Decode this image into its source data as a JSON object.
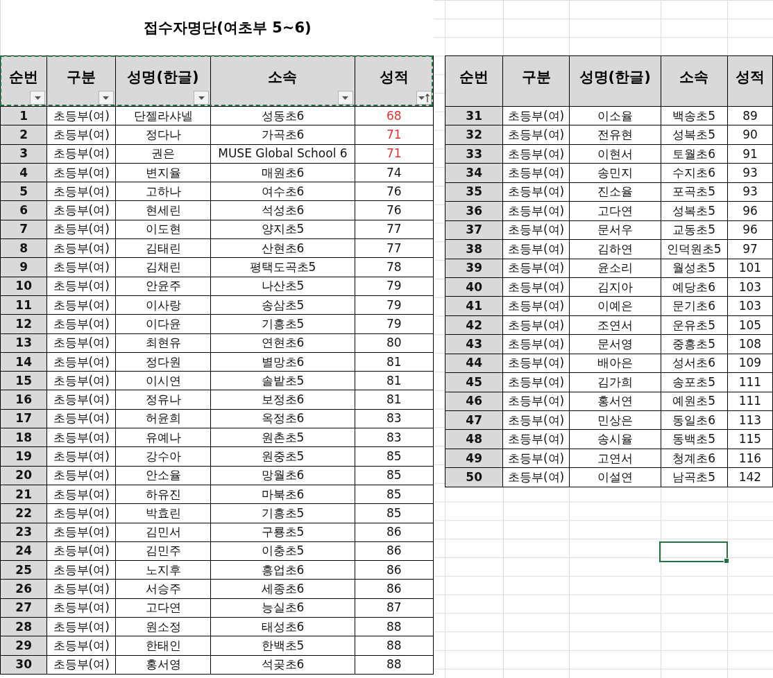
{
  "title": "접수자명단(여초부 5~6)",
  "cell_cursor": true,
  "copy_marquee": true,
  "tables": [
    {
      "columns": [
        {
          "label": "순번",
          "filter_button": true,
          "sorted": false
        },
        {
          "label": "구분",
          "filter_button": true,
          "sorted": false
        },
        {
          "label": "성명(한글)",
          "filter_button": true,
          "sorted": false
        },
        {
          "label": "소속",
          "filter_button": true,
          "sorted": false
        },
        {
          "label": "성적",
          "filter_button": true,
          "sorted": true
        }
      ],
      "rows": [
        {
          "no": "1",
          "category": "초등부(여)",
          "name": "단젤라샤넬",
          "school": "성동초6",
          "score": "68",
          "highlighted": true
        },
        {
          "no": "2",
          "category": "초등부(여)",
          "name": "정다나",
          "school": "가곡초6",
          "score": "71",
          "highlighted": true
        },
        {
          "no": "3",
          "category": "초등부(여)",
          "name": "권은",
          "school": "MUSE Global School 6",
          "score": "71",
          "highlighted": true
        },
        {
          "no": "4",
          "category": "초등부(여)",
          "name": "변지율",
          "school": "매원초6",
          "score": "74",
          "highlighted": false
        },
        {
          "no": "5",
          "category": "초등부(여)",
          "name": "고하나",
          "school": "여수초6",
          "score": "76",
          "highlighted": false
        },
        {
          "no": "6",
          "category": "초등부(여)",
          "name": "현세린",
          "school": "석성초6",
          "score": "76",
          "highlighted": false
        },
        {
          "no": "7",
          "category": "초등부(여)",
          "name": "이도현",
          "school": "양지초5",
          "score": "77",
          "highlighted": false
        },
        {
          "no": "8",
          "category": "초등부(여)",
          "name": "김태린",
          "school": "산현초6",
          "score": "77",
          "highlighted": false
        },
        {
          "no": "9",
          "category": "초등부(여)",
          "name": "김채린",
          "school": "평택도곡초5",
          "score": "78",
          "highlighted": false
        },
        {
          "no": "10",
          "category": "초등부(여)",
          "name": "안윤주",
          "school": "나산초5",
          "score": "79",
          "highlighted": false
        },
        {
          "no": "11",
          "category": "초등부(여)",
          "name": "이사랑",
          "school": "송삼초5",
          "score": "79",
          "highlighted": false
        },
        {
          "no": "12",
          "category": "초등부(여)",
          "name": "이다윤",
          "school": "기흥초5",
          "score": "79",
          "highlighted": false
        },
        {
          "no": "13",
          "category": "초등부(여)",
          "name": "최현유",
          "school": "연현초6",
          "score": "80",
          "highlighted": false
        },
        {
          "no": "14",
          "category": "초등부(여)",
          "name": "정다원",
          "school": "별망초6",
          "score": "81",
          "highlighted": false
        },
        {
          "no": "15",
          "category": "초등부(여)",
          "name": "이시연",
          "school": "솔밭초5",
          "score": "81",
          "highlighted": false
        },
        {
          "no": "16",
          "category": "초등부(여)",
          "name": "정유나",
          "school": "보정초6",
          "score": "81",
          "highlighted": false
        },
        {
          "no": "17",
          "category": "초등부(여)",
          "name": "허윤희",
          "school": "옥정초6",
          "score": "83",
          "highlighted": false
        },
        {
          "no": "18",
          "category": "초등부(여)",
          "name": "유예나",
          "school": "원촌초5",
          "score": "83",
          "highlighted": false
        },
        {
          "no": "19",
          "category": "초등부(여)",
          "name": "강수아",
          "school": "원중초5",
          "score": "85",
          "highlighted": false
        },
        {
          "no": "20",
          "category": "초등부(여)",
          "name": "안소율",
          "school": "망월초6",
          "score": "85",
          "highlighted": false
        },
        {
          "no": "21",
          "category": "초등부(여)",
          "name": "하유진",
          "school": "마북초6",
          "score": "85",
          "highlighted": false
        },
        {
          "no": "22",
          "category": "초등부(여)",
          "name": "박효린",
          "school": "기흥초5",
          "score": "85",
          "highlighted": false
        },
        {
          "no": "23",
          "category": "초등부(여)",
          "name": "김민서",
          "school": "구룡초5",
          "score": "86",
          "highlighted": false
        },
        {
          "no": "24",
          "category": "초등부(여)",
          "name": "김민주",
          "school": "이충초5",
          "score": "86",
          "highlighted": false
        },
        {
          "no": "25",
          "category": "초등부(여)",
          "name": "노지후",
          "school": "흥업초6",
          "score": "86",
          "highlighted": false
        },
        {
          "no": "26",
          "category": "초등부(여)",
          "name": "서승주",
          "school": "세종초6",
          "score": "86",
          "highlighted": false
        },
        {
          "no": "27",
          "category": "초등부(여)",
          "name": "고다연",
          "school": "능실초6",
          "score": "87",
          "highlighted": false
        },
        {
          "no": "28",
          "category": "초등부(여)",
          "name": "원소정",
          "school": "태성초6",
          "score": "88",
          "highlighted": false
        },
        {
          "no": "29",
          "category": "초등부(여)",
          "name": "한태인",
          "school": "한백초5",
          "score": "88",
          "highlighted": false
        },
        {
          "no": "30",
          "category": "초등부(여)",
          "name": "홍서영",
          "school": "석곶초6",
          "score": "88",
          "highlighted": false
        }
      ]
    },
    {
      "columns": [
        {
          "label": "순번"
        },
        {
          "label": "구분"
        },
        {
          "label": "성명(한글)"
        },
        {
          "label": "소속"
        },
        {
          "label": "성적"
        }
      ],
      "rows": [
        {
          "no": "31",
          "category": "초등부(여)",
          "name": "이소율",
          "school": "백송초5",
          "score": "89",
          "highlighted": false
        },
        {
          "no": "32",
          "category": "초등부(여)",
          "name": "전유현",
          "school": "성복초5",
          "score": "90",
          "highlighted": false
        },
        {
          "no": "33",
          "category": "초등부(여)",
          "name": "이현서",
          "school": "토월초6",
          "score": "91",
          "highlighted": false
        },
        {
          "no": "34",
          "category": "초등부(여)",
          "name": "송민지",
          "school": "수지초6",
          "score": "93",
          "highlighted": false
        },
        {
          "no": "35",
          "category": "초등부(여)",
          "name": "진소율",
          "school": "포곡초5",
          "score": "93",
          "highlighted": false
        },
        {
          "no": "36",
          "category": "초등부(여)",
          "name": "고다연",
          "school": "성복초5",
          "score": "96",
          "highlighted": false
        },
        {
          "no": "37",
          "category": "초등부(여)",
          "name": "문서우",
          "school": "교동초5",
          "score": "96",
          "highlighted": false
        },
        {
          "no": "38",
          "category": "초등부(여)",
          "name": "김하연",
          "school": "인덕원초5",
          "score": "97",
          "highlighted": false
        },
        {
          "no": "39",
          "category": "초등부(여)",
          "name": "윤소리",
          "school": "월성초5",
          "score": "101",
          "highlighted": false
        },
        {
          "no": "40",
          "category": "초등부(여)",
          "name": "김지아",
          "school": "예당초6",
          "score": "103",
          "highlighted": false
        },
        {
          "no": "41",
          "category": "초등부(여)",
          "name": "이예은",
          "school": "문기초6",
          "score": "103",
          "highlighted": false
        },
        {
          "no": "42",
          "category": "초등부(여)",
          "name": "조연서",
          "school": "운유초5",
          "score": "105",
          "highlighted": false
        },
        {
          "no": "43",
          "category": "초등부(여)",
          "name": "문서영",
          "school": "중흥초5",
          "score": "108",
          "highlighted": false
        },
        {
          "no": "44",
          "category": "초등부(여)",
          "name": "배아은",
          "school": "성서초6",
          "score": "109",
          "highlighted": false
        },
        {
          "no": "45",
          "category": "초등부(여)",
          "name": "김가희",
          "school": "송포초5",
          "score": "111",
          "highlighted": false
        },
        {
          "no": "46",
          "category": "초등부(여)",
          "name": "홍서연",
          "school": "예원초5",
          "score": "111",
          "highlighted": false
        },
        {
          "no": "47",
          "category": "초등부(여)",
          "name": "민상은",
          "school": "동일초6",
          "score": "113",
          "highlighted": false
        },
        {
          "no": "48",
          "category": "초등부(여)",
          "name": "송시율",
          "school": "동백초5",
          "score": "115",
          "highlighted": false
        },
        {
          "no": "49",
          "category": "초등부(여)",
          "name": "고연서",
          "school": "청계초6",
          "score": "116",
          "highlighted": false
        },
        {
          "no": "50",
          "category": "초등부(여)",
          "name": "이설연",
          "school": "남곡초5",
          "score": "142",
          "highlighted": false
        }
      ]
    }
  ]
}
